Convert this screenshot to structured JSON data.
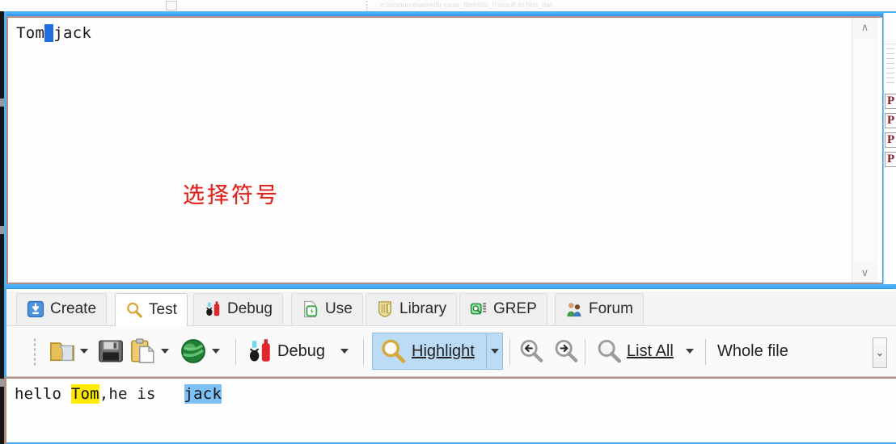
{
  "window": {
    "ghost_top_text": "e:\\resource\\workdir    case_filefolds_0        result to bhs_dat"
  },
  "editor": {
    "text_before": "Tom",
    "selection": " ",
    "text_after": "jack",
    "annotation": "选择符号",
    "annotation_color": "#e0211a",
    "scrollbar": {
      "up_arrow": "∧",
      "down_arrow": "∨"
    }
  },
  "side_panel": {
    "items": [
      "P",
      "P",
      "P",
      "P"
    ]
  },
  "tabs": [
    {
      "label": "Create",
      "icon": "download-blue-icon",
      "active": false
    },
    {
      "label": "Test",
      "icon": "magnifier-icon",
      "active": true
    },
    {
      "label": "Debug",
      "icon": "bug-bottle-icon",
      "active": false
    },
    {
      "label": "Use",
      "icon": "page-bolt-icon",
      "active": false
    },
    {
      "label": "Library",
      "icon": "shield-book-icon",
      "active": false
    },
    {
      "label": "GREP",
      "icon": "grep-green-icon",
      "active": false
    },
    {
      "label": "Forum",
      "icon": "people-icon",
      "active": false
    }
  ],
  "toolbar": {
    "open_label": "",
    "open_icon": "folder-open-icon",
    "save_icon": "save-disk-icon",
    "paste_icon": "clipboard-paste-icon",
    "globe_icon": "globe-green-icon",
    "debug_label": "Debug",
    "debug_icon": "bug-bottle-icon",
    "highlight_label": "Highlight",
    "highlight_icon": "magnifier-gold-icon",
    "highlight_selected": true,
    "find_prev_icon": "search-back-icon",
    "find_next_icon": "search-forward-icon",
    "list_all_label": "List All",
    "list_all_icon": "magnifier-plain-icon",
    "scope_label": "Whole file",
    "overflow_icon": "chevron-down-icon",
    "accent_highlight_bg": "#bcdcf5"
  },
  "results": {
    "prefix": "hello ",
    "match1": "Tom",
    "middle": ",he is ",
    "gap": "  ",
    "match2": "jack",
    "match1_color": "#ffeb00",
    "match2_color": "#7cc0f7"
  }
}
